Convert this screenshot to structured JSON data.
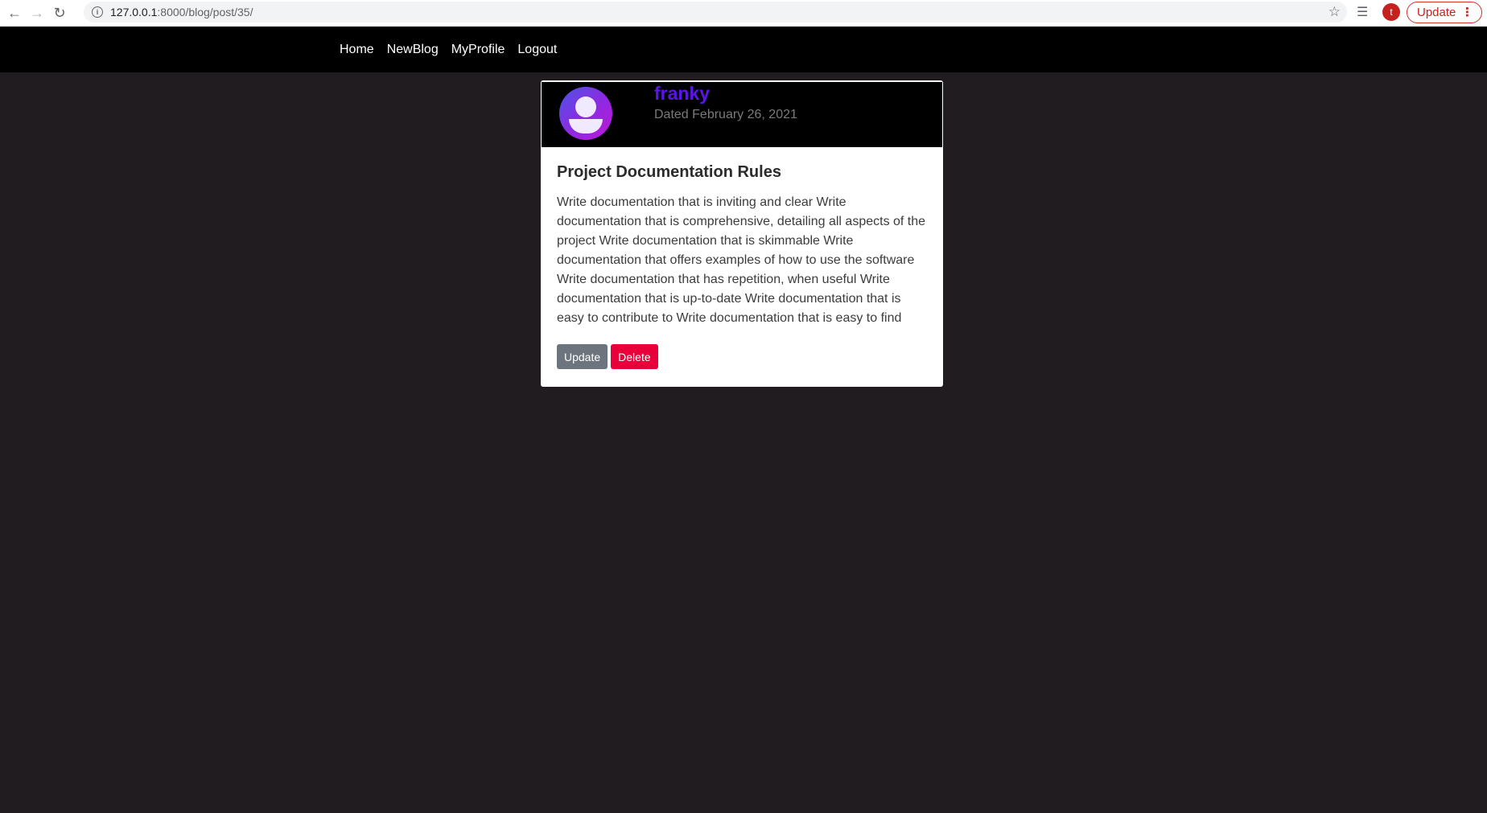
{
  "browser": {
    "url_host": "127.0.0.1",
    "url_path": ":8000/blog/post/35/",
    "profile_initial": "t",
    "update_label": "Update",
    "icons": [
      "back-icon",
      "forward-icon",
      "reload-icon",
      "info-icon",
      "star-icon",
      "reading-list-icon",
      "menu-dots-icon"
    ]
  },
  "nav": {
    "links": [
      "Home",
      "NewBlog",
      "MyProfile",
      "Logout"
    ]
  },
  "post": {
    "author": "franky",
    "date": "Dated February 26, 2021",
    "title": "Project Documentation Rules",
    "content": "Write documentation that is inviting and clear Write documentation that is comprehensive, detailing all aspects of the project Write documentation that is skimmable Write documentation that offers examples of how to use the software Write documentation that has repetition, when useful Write documentation that is up-to-date Write documentation that is easy to contribute to Write documentation that is easy to find",
    "update_label": "Update",
    "delete_label": "Delete"
  },
  "colors": {
    "page_bg": "#201c20",
    "nav_bg": "#000000",
    "author": "#5a16e8",
    "update_btn": "#6c757d",
    "delete_btn": "#e8003a"
  }
}
